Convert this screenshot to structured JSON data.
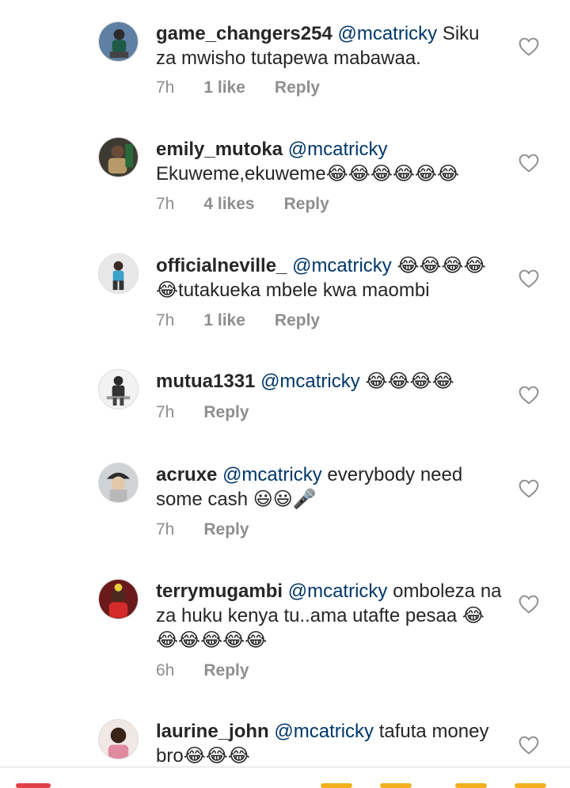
{
  "comments": [
    {
      "username": "game_changers254",
      "mention": "@mcatricky",
      "text": " Siku za mwisho tutapewa mabawaa.",
      "time": "7h",
      "likes": "1 like",
      "reply": "Reply"
    },
    {
      "username": "emily_mutoka",
      "mention": "@mcatricky",
      "text": " Ekuweme,ekuweme😂😂😂😂😂😂",
      "time": "7h",
      "likes": "4 likes",
      "reply": "Reply"
    },
    {
      "username": "officialneville_",
      "mention": "@mcatricky",
      "text": " 😂😂😂😂😂tutakueka mbele kwa maombi",
      "time": "7h",
      "likes": "1 like",
      "reply": "Reply"
    },
    {
      "username": "mutua1331",
      "mention": "@mcatricky",
      "text": " 😂😂😂😂",
      "time": "7h",
      "likes": "",
      "reply": "Reply"
    },
    {
      "username": "acruxe",
      "mention": "@mcatricky",
      "text": " everybody need some cash 😃😃🎤",
      "time": "7h",
      "likes": "",
      "reply": "Reply"
    },
    {
      "username": "terrymugambi",
      "mention": "@mcatricky",
      "text": " omboleza na za huku kenya tu..ama utafte pesaa 😂😂😂😂😂😂",
      "time": "6h",
      "likes": "",
      "reply": "Reply"
    },
    {
      "username": "laurine_john",
      "mention": "@mcatricky",
      "text": " tafuta money bro😂😂😂",
      "time": "",
      "likes": "",
      "reply": ""
    }
  ],
  "icons": {
    "like": "heart-outline-icon",
    "avatar": "avatar"
  },
  "colors": {
    "mention": "#00376b",
    "meta": "#8e8e8e",
    "text": "#262626"
  }
}
